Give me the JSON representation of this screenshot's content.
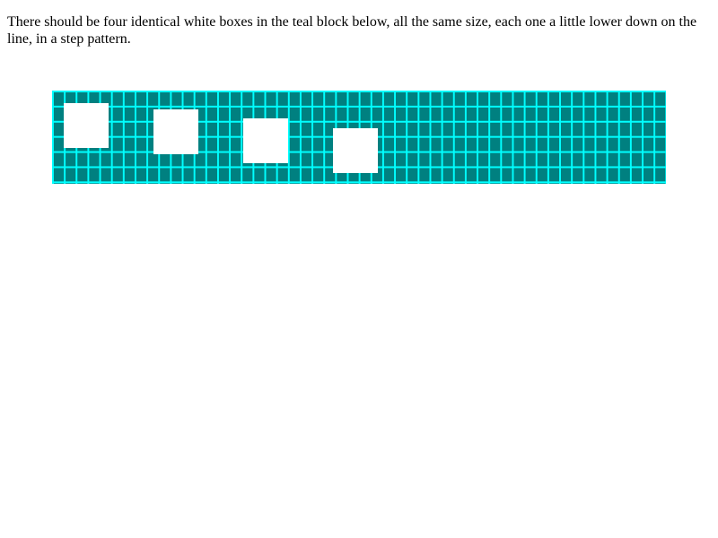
{
  "instruction_text": "There should be four identical white boxes in the teal block below, all the same size, each one a little lower down on the line, in a step pattern.",
  "colors": {
    "teal_block": "#008080",
    "grid_lines": "#00ffff",
    "boxes": "#ffffff",
    "text": "#000000"
  },
  "boxes": [
    {
      "name": "box-1"
    },
    {
      "name": "box-2"
    },
    {
      "name": "box-3"
    },
    {
      "name": "box-4"
    }
  ]
}
